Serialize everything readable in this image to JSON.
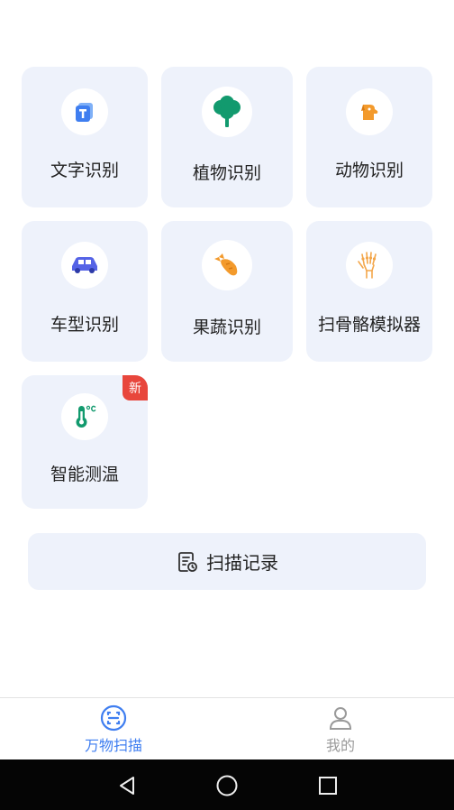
{
  "features": [
    {
      "label": "文字识别",
      "icon": "text-recognition-icon"
    },
    {
      "label": "植物识别",
      "icon": "tree-icon"
    },
    {
      "label": "动物识别",
      "icon": "dog-icon"
    },
    {
      "label": "车型识别",
      "icon": "car-icon"
    },
    {
      "label": "果蔬识别",
      "icon": "carrot-icon"
    },
    {
      "label": "扫骨骼模拟器",
      "icon": "hand-bone-icon"
    },
    {
      "label": "智能测温",
      "icon": "thermometer-icon",
      "badge": "新"
    }
  ],
  "scan_record": {
    "label": "扫描记录",
    "icon": "record-list-icon"
  },
  "tabs": [
    {
      "label": "万物扫描",
      "icon": "scan-face-icon",
      "active": true
    },
    {
      "label": "我的",
      "icon": "person-icon",
      "active": false
    }
  ],
  "colors": {
    "accent": "#3f7ef0",
    "card_bg": "#eef2fb",
    "badge": "#e8463c",
    "inactive": "#9a9a9a"
  }
}
